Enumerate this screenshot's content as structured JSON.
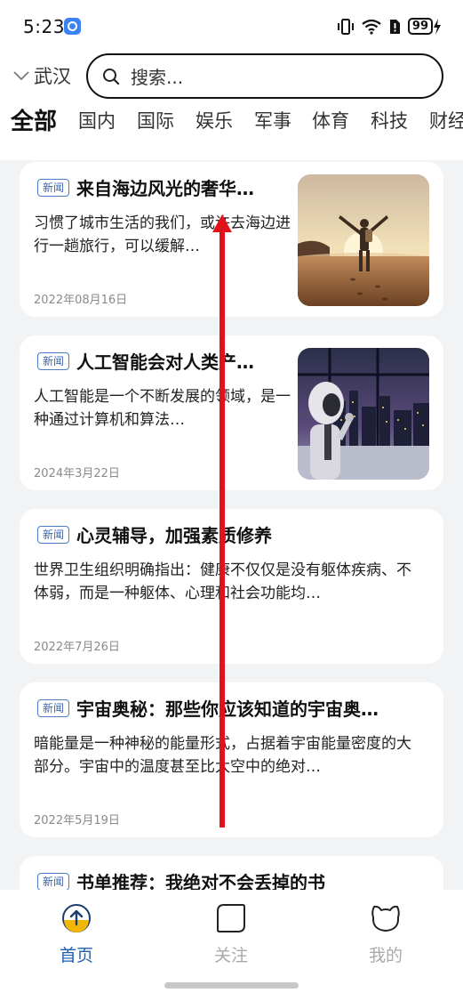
{
  "status_bar": {
    "time": "5:23",
    "battery": "99"
  },
  "header": {
    "city": "武汉",
    "search_placeholder": "搜索..."
  },
  "categories": [
    "全部",
    "国内",
    "国际",
    "娱乐",
    "军事",
    "体育",
    "科技",
    "财经"
  ],
  "news": [
    {
      "tag": "新闻",
      "title": "来自海边风光的奢华…",
      "desc": "习惯了城市生活的我们，或许去海边进行一趟旅行，可以缓解…",
      "date": "2022年08月16日",
      "thumb": "beach-traveler"
    },
    {
      "tag": "新闻",
      "title": "人工智能会对人类产…",
      "desc": "人工智能是一个不断发展的领域，是一种通过计算机和算法…",
      "date": "2024年3月22日",
      "thumb": "robot-thinking"
    },
    {
      "tag": "新闻",
      "title": "心灵辅导，加强素质修养",
      "desc": "世界卫生组织明确指出：健康不仅仅是没有躯体疾病、不体弱，而是一种躯体、心理和社会功能均…",
      "date": "2022年7月26日"
    },
    {
      "tag": "新闻",
      "title": "宇宙奥秘：那些你应该知道的宇宙奥…",
      "desc": "暗能量是一种神秘的能量形式，占据着宇宙能量密度的大部分。宇宙中的温度甚至比太空中的绝对…",
      "date": "2022年5月19日"
    },
    {
      "tag": "新闻",
      "title": "书单推荐：我绝对不会丢掉的书"
    }
  ],
  "tabbar": {
    "home": "首页",
    "follow": "关注",
    "mine": "我的"
  },
  "colors": {
    "accent": "#1f5fb0",
    "home_icon": "#f2b705",
    "swipe_annotation": "#e3121a"
  }
}
